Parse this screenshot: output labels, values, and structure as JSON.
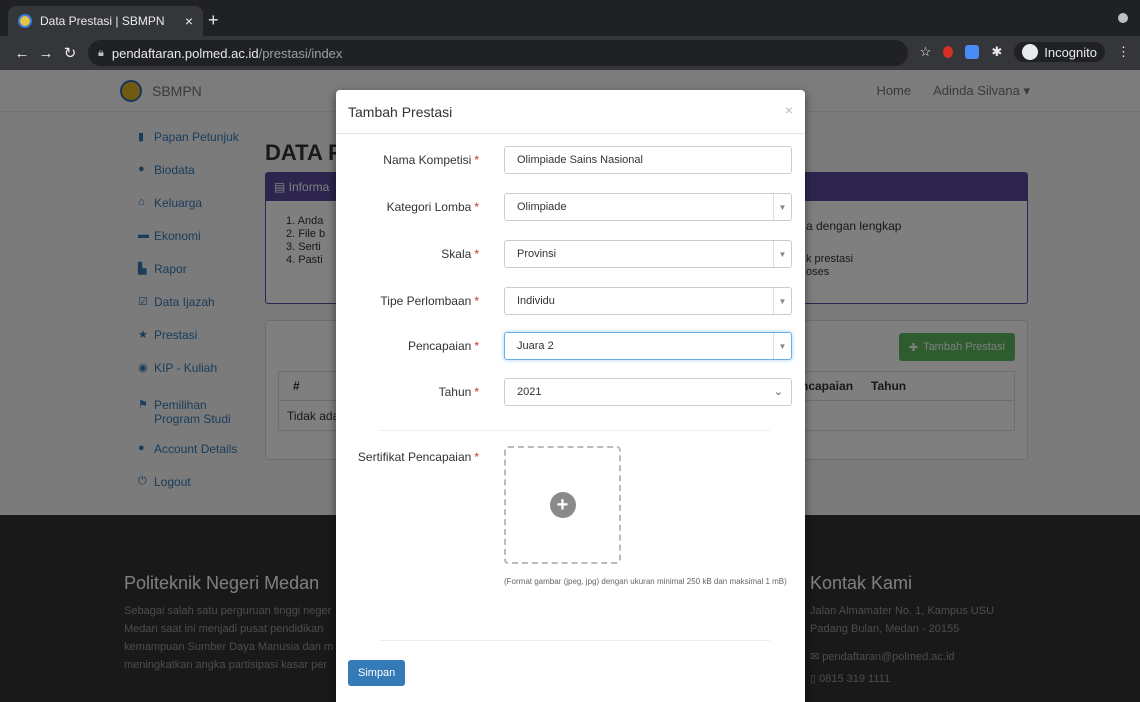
{
  "browser": {
    "tab_title": "Data Prestasi | SBMPN",
    "tab_close": "×",
    "new_tab": "+",
    "url_host": "pendaftaran.polmed.ac.id",
    "url_path": "/prestasi/index",
    "incognito_label": "Incognito"
  },
  "navbar": {
    "brand": "SBMPN",
    "home": "Home",
    "user": "Adinda Silvana ▾"
  },
  "sidebar": {
    "items": [
      {
        "icon": "bookmark-icon",
        "label": "Papan Petunjuk"
      },
      {
        "icon": "info-icon",
        "label": "Biodata"
      },
      {
        "icon": "home-icon",
        "label": "Keluarga"
      },
      {
        "icon": "money-icon",
        "label": "Ekonomi"
      },
      {
        "icon": "file-icon",
        "label": "Rapor"
      },
      {
        "icon": "edit-icon",
        "label": "Data Ijazah"
      },
      {
        "icon": "star-icon",
        "label": "Prestasi"
      },
      {
        "icon": "target-icon",
        "label": "KIP - Kuliah"
      },
      {
        "icon": "flag-icon",
        "label": "Pemilihan Program Studi"
      },
      {
        "icon": "user-icon",
        "label": "Account Details"
      },
      {
        "icon": "power-icon",
        "label": "Logout"
      }
    ]
  },
  "main": {
    "title": "DATA P",
    "info_header": "Informa",
    "info_items": [
      "1. Anda",
      "2. File b",
      "3. Serti",
      "4. Pasti"
    ],
    "info_right": [
      "a dengan lengkap"
    ],
    "info_right2": [
      "k prestasi",
      "oses"
    ],
    "add_button": "Tambah Prestasi",
    "table_headers": [
      "#",
      "ncapaian",
      "Tahun"
    ],
    "table_empty": "Tidak ada"
  },
  "footer": {
    "left_title": "Politeknik Negeri Medan",
    "left_text": [
      "Sebagai salah satu perguruan tinggi neger",
      "Medan saat ini menjadi pusat pendidikan",
      "kemampuan Sumber Daya Manusia dan m",
      "meningkatkan angka partisipasi kasar per"
    ],
    "right_title": "Kontak Kami",
    "address": [
      "Jalan Almamater No. 1, Kampus USU",
      "Padang Bulan, Medan - 20155"
    ],
    "email": "pendaftaran@polmed.ac.id",
    "phone": "0815 319 1111"
  },
  "modal": {
    "title": "Tambah Prestasi",
    "close": "×",
    "required_mark": "*",
    "fields": {
      "nama_kompetisi": {
        "label": "Nama Kompetisi",
        "value": "Olimpiade Sains Nasional"
      },
      "kategori_lomba": {
        "label": "Kategori Lomba",
        "value": "Olimpiade"
      },
      "skala": {
        "label": "Skala",
        "value": "Provinsi"
      },
      "tipe_perlombaan": {
        "label": "Tipe Perlombaan",
        "value": "Individu"
      },
      "pencapaian": {
        "label": "Pencapaian",
        "value": "Juara 2"
      },
      "tahun": {
        "label": "Tahun",
        "value": "2021"
      }
    },
    "sertifikat_label": "Sertifikat Pencapaian",
    "upload_note": "(Format gambar (jpeg, jpg) dengan ukuran minimal 250 kB dan maksimal 1 mB)",
    "save_button": "Simpan"
  }
}
